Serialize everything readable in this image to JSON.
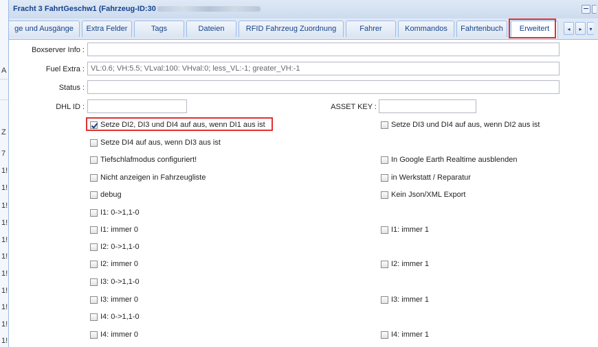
{
  "window": {
    "title": "Fracht 3 FahrtGeschw1 (Fahrzeug-ID:30"
  },
  "left_strip": [
    "A",
    "Z",
    "7",
    "1!",
    "1!",
    "1!",
    "1!",
    "1!",
    "1!",
    "1!",
    "1!",
    "1!",
    "1!",
    "1!",
    "1!",
    "1!",
    "1!"
  ],
  "tabs": [
    {
      "label": "ge und Ausgänge",
      "active": false
    },
    {
      "label": "Extra Felder",
      "active": false
    },
    {
      "label": "Tags",
      "active": false
    },
    {
      "label": "Dateien",
      "active": false
    },
    {
      "label": "RFID Fahrzeug Zuordnung",
      "active": false
    },
    {
      "label": "Fahrer",
      "active": false
    },
    {
      "label": "Kommandos",
      "active": false
    },
    {
      "label": "Fahrtenbuch",
      "active": false
    },
    {
      "label": "Erweitert",
      "active": true
    }
  ],
  "tab_scroll": {
    "left": "◂",
    "right": "▸",
    "menu": "▾"
  },
  "fields": {
    "boxserver_label": "Boxserver Info :",
    "boxserver_value": "",
    "fuel_label": "Fuel Extra :",
    "fuel_value": "VL:0.6; VH:5.5; VLval:100: VHval:0; less_VL:-1;  greater_VH:-1",
    "status_label": "Status :",
    "status_value": "",
    "dhl_label": "DHL ID :",
    "dhl_value": "",
    "asset_label": "ASSET KEY :",
    "asset_value": ""
  },
  "checkboxes_left": [
    {
      "label": "Setze DI2, DI3 und DI4 auf aus, wenn DI1 aus ist",
      "checked": true
    },
    {
      "label": "Setze DI4 auf aus, wenn DI3 aus ist",
      "checked": false
    },
    {
      "label": "Tiefschlafmodus configuriert!",
      "checked": false
    },
    {
      "label": "Nicht anzeigen in Fahrzeugliste",
      "checked": false
    },
    {
      "label": "debug",
      "checked": false
    },
    {
      "label": "I1: 0->1,1-0",
      "checked": false
    },
    {
      "label": "I1: immer 0",
      "checked": false
    },
    {
      "label": "I2: 0->1,1-0",
      "checked": false
    },
    {
      "label": "I2: immer 0",
      "checked": false
    },
    {
      "label": "I3: 0->1,1-0",
      "checked": false
    },
    {
      "label": "I3: immer 0",
      "checked": false
    },
    {
      "label": "I4: 0->1,1-0",
      "checked": false
    },
    {
      "label": "I4: immer 0",
      "checked": false
    }
  ],
  "checkboxes_right": [
    {
      "label": "Setze DI3 und DI4 auf aus, wenn DI2 aus ist",
      "checked": false
    },
    {
      "label": "In Google Earth Realtime ausblenden",
      "checked": false
    },
    {
      "label": "in Werkstatt / Reparatur",
      "checked": false
    },
    {
      "label": "Kein Json/XML Export",
      "checked": false
    },
    {
      "label": "I1: immer 1",
      "checked": false
    },
    {
      "label": "I2: immer 1",
      "checked": false
    },
    {
      "label": "I3: immer 1",
      "checked": false
    },
    {
      "label": "I4: immer 1",
      "checked": false
    }
  ],
  "colors": {
    "highlight": "#e03030",
    "title_text": "#15428b",
    "border_blue": "#99bbe8"
  }
}
